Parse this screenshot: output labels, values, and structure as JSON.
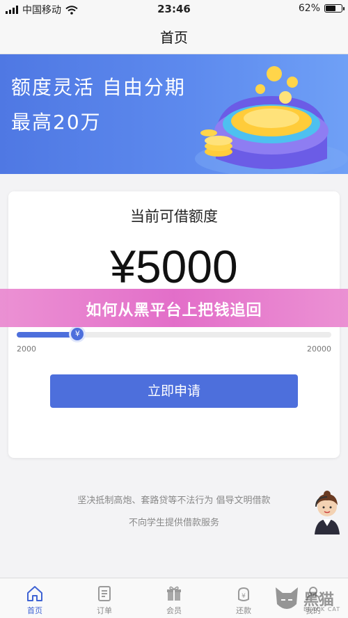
{
  "status_bar": {
    "carrier": "中国移动",
    "time": "23:46",
    "battery": "62%",
    "battery_level": 0.62
  },
  "nav": {
    "title": "首页"
  },
  "banner": {
    "line1": "额度灵活 自由分期",
    "line2": "最高20万"
  },
  "loan_card": {
    "title": "当前可借额度",
    "amount": "¥5000",
    "slider": {
      "min_label": "2000",
      "max_label": "20000",
      "thumb_symbol": "¥",
      "min": 2000,
      "max": 20000,
      "value": 5000
    },
    "apply_label": "立即申请"
  },
  "overlay": {
    "text": "如何从黑平台上把钱追回"
  },
  "notices": {
    "line1": "坚决抵制高炮、套路贷等不法行为 倡导文明借款",
    "line2": "不向学生提供借款服务"
  },
  "tabs": [
    {
      "label": "首页",
      "icon": "home-icon",
      "active": true
    },
    {
      "label": "订单",
      "icon": "order-icon",
      "active": false
    },
    {
      "label": "会员",
      "icon": "gift-icon",
      "active": false
    },
    {
      "label": "还款",
      "icon": "repay-icon",
      "active": false
    },
    {
      "label": "我的",
      "icon": "profile-icon",
      "active": false
    }
  ],
  "watermark": {
    "title": "黑猫",
    "subtitle": "BLACK CAT"
  },
  "colors": {
    "primary": "#4d6fdc",
    "banner": "#5d8aee",
    "overlay": "#e062c4"
  }
}
